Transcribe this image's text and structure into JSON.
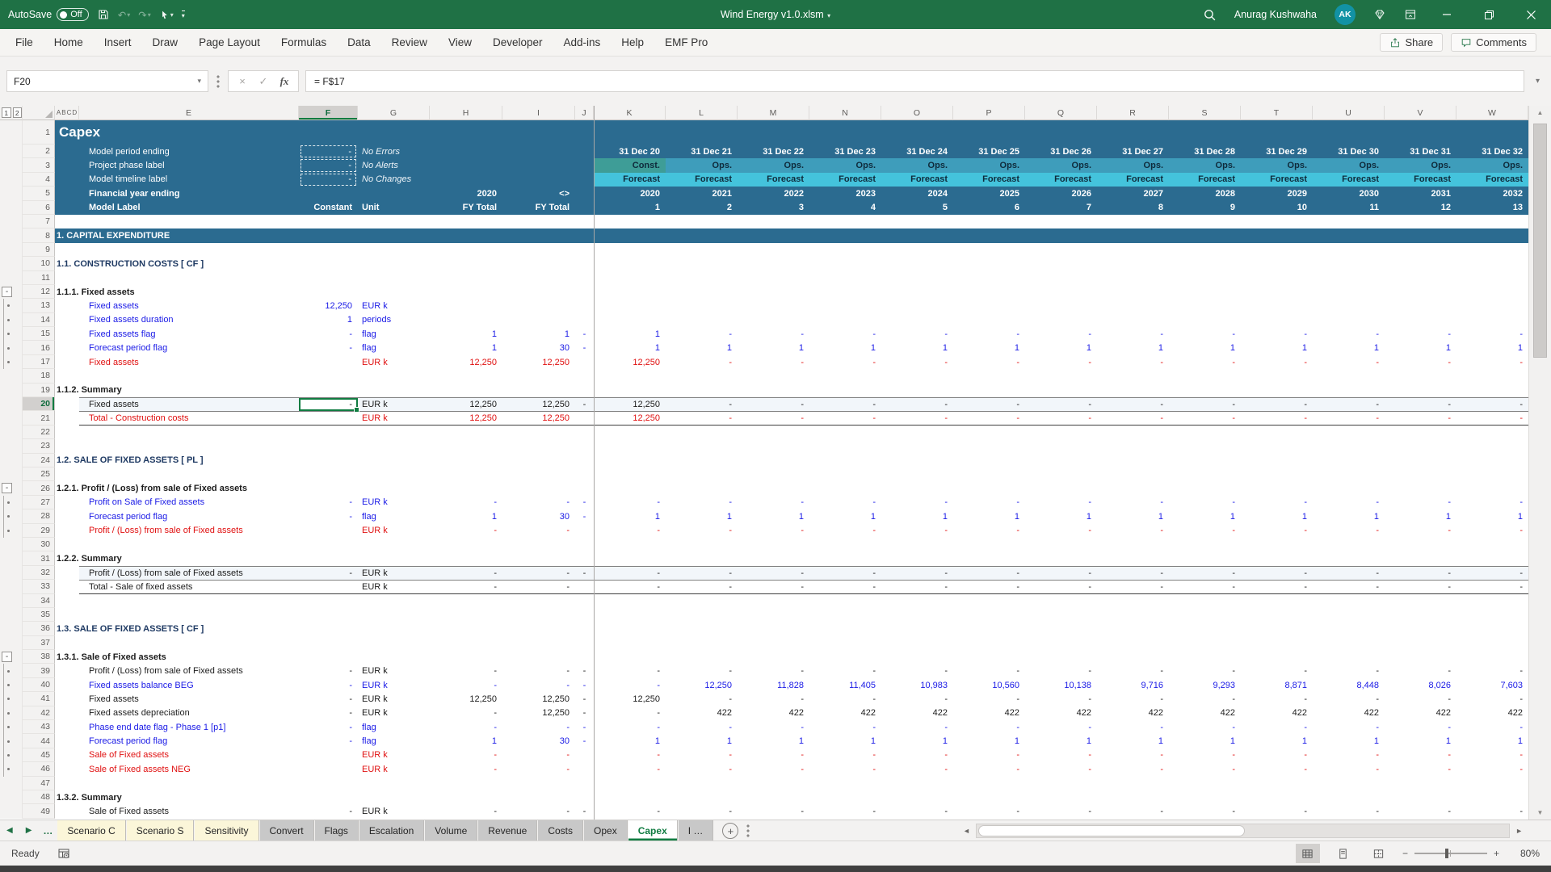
{
  "colors": {
    "titlebar_green": "#1F7145",
    "accent_green": "#107C41",
    "header_blue": "#2B6B90",
    "const_teal": "#3E9D97",
    "ops_teal": "#3E9DBB",
    "forecast_cyan": "#44C3DC",
    "input_blue": "#1A1AE6",
    "result_red": "#E01010",
    "section_navy": "#1F3A63",
    "summary_band": "#F2F6FA",
    "tab_yellow": "#FBF6D9",
    "tab_gray": "#C8C8C8"
  },
  "icons": {
    "dropdown": "▾",
    "undo": "↶",
    "redo": "↷",
    "collapse": "-",
    "formula_cancel": "×",
    "formula_enter": "✓",
    "fx": "fx",
    "expand_formula": "▾",
    "nav_left": "◀",
    "nav_right": "▶",
    "overflow": "…",
    "add_sheet": "+",
    "scroll_up": "▲",
    "scroll_down": "▼",
    "hscroll_left": "◄",
    "hscroll_right": "►",
    "zoom_out": "−",
    "zoom_in": "+"
  },
  "title_bar": {
    "autosave_label": "AutoSave",
    "autosave_state": "Off",
    "document_title": "Wind Energy v1.0.xlsm",
    "user_name": "Anurag Kushwaha",
    "user_initials": "AK"
  },
  "menu_bar": {
    "tabs": [
      "File",
      "Home",
      "Insert",
      "Draw",
      "Page Layout",
      "Formulas",
      "Data",
      "Review",
      "View",
      "Developer",
      "Add-ins",
      "Help",
      "EMF Pro"
    ],
    "share_label": "Share",
    "comments_label": "Comments"
  },
  "formula_bar": {
    "name_box": "F20",
    "formula": "= F$17"
  },
  "grid": {
    "outline_levels": [
      "1",
      "2"
    ],
    "small_columns": [
      "A",
      "B",
      "C",
      "D"
    ],
    "columns": [
      "E",
      "F",
      "G",
      "H",
      "I",
      "J",
      "K",
      "L",
      "M",
      "N",
      "O",
      "P",
      "Q",
      "R",
      "S",
      "T",
      "U",
      "V",
      "W"
    ],
    "selected_column": "F",
    "selected_row": 20,
    "rows": [
      {
        "n": 1,
        "t": "title",
        "e": "Capex"
      },
      {
        "n": 2,
        "t": "hdr",
        "e": "Model period ending",
        "f": "-",
        "fbox": true,
        "g": "No Errors",
        "gitalic": true,
        "k": [
          "31 Dec 20",
          "31 Dec 21",
          "31 Dec 22",
          "31 Dec 23",
          "31 Dec 24",
          "31 Dec 25",
          "31 Dec 26",
          "31 Dec 27",
          "31 Dec 28",
          "31 Dec 29",
          "31 Dec 30",
          "31 Dec 31",
          "31 Dec 32"
        ]
      },
      {
        "n": 3,
        "t": "hdr",
        "e": "Project phase label",
        "f": "-",
        "fbox": true,
        "g": "No Alerts",
        "gitalic": true,
        "kband": "phase",
        "k": [
          "Const.",
          "Ops.",
          "Ops.",
          "Ops.",
          "Ops.",
          "Ops.",
          "Ops.",
          "Ops.",
          "Ops.",
          "Ops.",
          "Ops.",
          "Ops.",
          "Ops."
        ]
      },
      {
        "n": 4,
        "t": "hdr",
        "e": "Model timeline label",
        "f": "-",
        "fbox": true,
        "g": "No Changes",
        "gitalic": true,
        "kband": "forecast",
        "k": [
          "Forecast",
          "Forecast",
          "Forecast",
          "Forecast",
          "Forecast",
          "Forecast",
          "Forecast",
          "Forecast",
          "Forecast",
          "Forecast",
          "Forecast",
          "Forecast",
          "Forecast"
        ]
      },
      {
        "n": 5,
        "t": "hdr",
        "e": "Financial year ending",
        "ebold": true,
        "h": "2020",
        "i": "<>",
        "k": [
          "2020",
          "2021",
          "2022",
          "2023",
          "2024",
          "2025",
          "2026",
          "2027",
          "2028",
          "2029",
          "2030",
          "2031",
          "2032"
        ]
      },
      {
        "n": 6,
        "t": "hdr",
        "e": "Model Label",
        "ebold": true,
        "f": "Constant",
        "g": "Unit",
        "h": "FY Total",
        "i": "FY Total",
        "k": [
          "1",
          "2",
          "3",
          "4",
          "5",
          "6",
          "7",
          "8",
          "9",
          "10",
          "11",
          "12",
          "13"
        ]
      },
      {
        "n": 7,
        "t": "empty"
      },
      {
        "n": 8,
        "t": "band",
        "e": "1. CAPITAL EXPENDITURE"
      },
      {
        "n": 9,
        "t": "empty"
      },
      {
        "n": 10,
        "t": "section",
        "e": "1.1. CONSTRUCTION COSTS [ CF ]"
      },
      {
        "n": 11,
        "t": "empty"
      },
      {
        "n": 12,
        "t": "sub",
        "e": "1.1.1. Fixed assets",
        "ol": "minus"
      },
      {
        "n": 13,
        "t": "data",
        "c": "blue",
        "e": "Fixed assets",
        "f": "12,250",
        "g": "EUR k",
        "ol": "dot"
      },
      {
        "n": 14,
        "t": "data",
        "c": "blue",
        "e": "Fixed assets duration",
        "f": "1",
        "g": "periods",
        "ol": "dot"
      },
      {
        "n": 15,
        "t": "data",
        "c": "blue",
        "e": "Fixed assets flag",
        "f": "-",
        "g": "flag",
        "h": "1",
        "i": "1",
        "j": "-",
        "ol": "dot",
        "k": [
          "1",
          "-",
          "-",
          "-",
          "-",
          "-",
          "-",
          "-",
          "-",
          "-",
          "-",
          "-",
          "-"
        ]
      },
      {
        "n": 16,
        "t": "data",
        "c": "blue",
        "e": "Forecast period flag",
        "f": "-",
        "g": "flag",
        "h": "1",
        "i": "30",
        "j": "-",
        "ol": "dot",
        "k": [
          "1",
          "1",
          "1",
          "1",
          "1",
          "1",
          "1",
          "1",
          "1",
          "1",
          "1",
          "1",
          "1"
        ]
      },
      {
        "n": 17,
        "t": "data",
        "c": "red",
        "e": "Fixed assets",
        "g": "EUR k",
        "h": "12,250",
        "i": "12,250",
        "ol": "dot",
        "k": [
          "12,250",
          "-",
          "-",
          "-",
          "-",
          "-",
          "-",
          "-",
          "-",
          "-",
          "-",
          "-",
          "-"
        ]
      },
      {
        "n": 18,
        "t": "empty"
      },
      {
        "n": 19,
        "t": "sub",
        "e": "1.1.2. Summary"
      },
      {
        "n": 20,
        "t": "data",
        "c": "black",
        "e": "Fixed assets",
        "f": "-",
        "sel": true,
        "g": "EUR k",
        "h": "12,250",
        "i": "12,250",
        "j": "-",
        "bg": true,
        "bt": true,
        "k": [
          "12,250",
          "-",
          "-",
          "-",
          "-",
          "-",
          "-",
          "-",
          "-",
          "-",
          "-",
          "-",
          "-"
        ]
      },
      {
        "n": 21,
        "t": "data",
        "c": "red",
        "e": "Total - Construction costs",
        "g": "EUR k",
        "h": "12,250",
        "i": "12,250",
        "bt": true,
        "bb": true,
        "k": [
          "12,250",
          "-",
          "-",
          "-",
          "-",
          "-",
          "-",
          "-",
          "-",
          "-",
          "-",
          "-",
          "-"
        ]
      },
      {
        "n": 22,
        "t": "empty"
      },
      {
        "n": 23,
        "t": "empty"
      },
      {
        "n": 24,
        "t": "section",
        "e": "1.2. SALE OF FIXED ASSETS [ PL ]"
      },
      {
        "n": 25,
        "t": "empty"
      },
      {
        "n": 26,
        "t": "sub",
        "e": "1.2.1. Profit / (Loss) from sale of Fixed assets",
        "ol": "minus"
      },
      {
        "n": 27,
        "t": "data",
        "c": "blue",
        "e": "Profit on Sale of Fixed assets",
        "f": "-",
        "g": "EUR k",
        "h": "-",
        "i": "-",
        "j": "-",
        "ol": "dot",
        "k": [
          "-",
          "-",
          "-",
          "-",
          "-",
          "-",
          "-",
          "-",
          "-",
          "-",
          "-",
          "-",
          "-"
        ]
      },
      {
        "n": 28,
        "t": "data",
        "c": "blue",
        "e": "Forecast period flag",
        "f": "-",
        "g": "flag",
        "h": "1",
        "i": "30",
        "j": "-",
        "ol": "dot",
        "k": [
          "1",
          "1",
          "1",
          "1",
          "1",
          "1",
          "1",
          "1",
          "1",
          "1",
          "1",
          "1",
          "1"
        ]
      },
      {
        "n": 29,
        "t": "data",
        "c": "red",
        "e": "Profit / (Loss) from sale of Fixed assets",
        "g": "EUR k",
        "h": "-",
        "i": "-",
        "ol": "dot",
        "k": [
          "-",
          "-",
          "-",
          "-",
          "-",
          "-",
          "-",
          "-",
          "-",
          "-",
          "-",
          "-",
          "-"
        ]
      },
      {
        "n": 30,
        "t": "empty"
      },
      {
        "n": 31,
        "t": "sub",
        "e": "1.2.2. Summary"
      },
      {
        "n": 32,
        "t": "data",
        "c": "black",
        "e": "Profit / (Loss) from sale of Fixed assets",
        "f": "-",
        "g": "EUR k",
        "h": "-",
        "i": "-",
        "j": "-",
        "bg": true,
        "bt": true,
        "k": [
          "-",
          "-",
          "-",
          "-",
          "-",
          "-",
          "-",
          "-",
          "-",
          "-",
          "-",
          "-",
          "-"
        ]
      },
      {
        "n": 33,
        "t": "data",
        "c": "black",
        "e": "Total - Sale of fixed assets",
        "g": "EUR k",
        "h": "-",
        "i": "-",
        "bt": true,
        "bb": true,
        "k": [
          "-",
          "-",
          "-",
          "-",
          "-",
          "-",
          "-",
          "-",
          "-",
          "-",
          "-",
          "-",
          "-"
        ]
      },
      {
        "n": 34,
        "t": "empty"
      },
      {
        "n": 35,
        "t": "empty"
      },
      {
        "n": 36,
        "t": "section",
        "e": "1.3. SALE OF FIXED ASSETS [ CF ]"
      },
      {
        "n": 37,
        "t": "empty"
      },
      {
        "n": 38,
        "t": "sub",
        "e": "1.3.1. Sale of Fixed assets",
        "ol": "minus"
      },
      {
        "n": 39,
        "t": "data",
        "c": "black",
        "e": "Profit / (Loss) from sale of Fixed assets",
        "f": "-",
        "g": "EUR k",
        "h": "-",
        "i": "-",
        "j": "-",
        "ol": "dot",
        "k": [
          "-",
          "-",
          "-",
          "-",
          "-",
          "-",
          "-",
          "-",
          "-",
          "-",
          "-",
          "-",
          "-"
        ]
      },
      {
        "n": 40,
        "t": "data",
        "c": "blue",
        "e": "Fixed assets balance BEG",
        "f": "-",
        "g": "EUR k",
        "h": "-",
        "i": "-",
        "j": "-",
        "ol": "dot",
        "k": [
          "-",
          "12,250",
          "11,828",
          "11,405",
          "10,983",
          "10,560",
          "10,138",
          "9,716",
          "9,293",
          "8,871",
          "8,448",
          "8,026",
          "7,603"
        ]
      },
      {
        "n": 41,
        "t": "data",
        "c": "black",
        "e": "Fixed assets",
        "f": "-",
        "g": "EUR k",
        "h": "12,250",
        "i": "12,250",
        "j": "-",
        "ol": "dot",
        "k": [
          "12,250",
          "-",
          "-",
          "-",
          "-",
          "-",
          "-",
          "-",
          "-",
          "-",
          "-",
          "-",
          "-"
        ]
      },
      {
        "n": 42,
        "t": "data",
        "c": "black",
        "e": "Fixed assets depreciation",
        "f": "-",
        "g": "EUR k",
        "h": "-",
        "i": "12,250",
        "j": "-",
        "ol": "dot",
        "k": [
          "-",
          "422",
          "422",
          "422",
          "422",
          "422",
          "422",
          "422",
          "422",
          "422",
          "422",
          "422",
          "422"
        ]
      },
      {
        "n": 43,
        "t": "data",
        "c": "blue",
        "e": "Phase end date flag - Phase 1 [p1]",
        "f": "-",
        "g": "flag",
        "h": "-",
        "i": "-",
        "j": "-",
        "ol": "dot",
        "k": [
          "-",
          "-",
          "-",
          "-",
          "-",
          "-",
          "-",
          "-",
          "-",
          "-",
          "-",
          "-",
          "-"
        ]
      },
      {
        "n": 44,
        "t": "data",
        "c": "blue",
        "e": "Forecast period flag",
        "f": "-",
        "g": "flag",
        "h": "1",
        "i": "30",
        "j": "-",
        "ol": "dot",
        "k": [
          "1",
          "1",
          "1",
          "1",
          "1",
          "1",
          "1",
          "1",
          "1",
          "1",
          "1",
          "1",
          "1"
        ]
      },
      {
        "n": 45,
        "t": "data",
        "c": "red",
        "e": "Sale of Fixed assets",
        "g": "EUR k",
        "h": "-",
        "i": "-",
        "ol": "dot",
        "k": [
          "-",
          "-",
          "-",
          "-",
          "-",
          "-",
          "-",
          "-",
          "-",
          "-",
          "-",
          "-",
          "-"
        ]
      },
      {
        "n": 46,
        "t": "data",
        "c": "red",
        "e": "Sale of Fixed assets NEG",
        "g": "EUR k",
        "h": "-",
        "i": "-",
        "ol": "dot",
        "k": [
          "-",
          "-",
          "-",
          "-",
          "-",
          "-",
          "-",
          "-",
          "-",
          "-",
          "-",
          "-",
          "-"
        ]
      },
      {
        "n": 47,
        "t": "empty"
      },
      {
        "n": 48,
        "t": "sub",
        "e": "1.3.2. Summary"
      },
      {
        "n": 49,
        "t": "data",
        "c": "black",
        "e": "Sale of Fixed assets",
        "f": "-",
        "g": "EUR k",
        "h": "-",
        "i": "-",
        "j": "-",
        "k": [
          "-",
          "-",
          "-",
          "-",
          "-",
          "-",
          "-",
          "-",
          "-",
          "-",
          "-",
          "-",
          "-"
        ]
      }
    ]
  },
  "sheet_bar": {
    "tabs": [
      {
        "label": "Scenario C",
        "style": "yellow"
      },
      {
        "label": "Scenario S",
        "style": "yellow"
      },
      {
        "label": "Sensitivity",
        "style": "yellow"
      },
      {
        "label": "Convert",
        "style": "gray"
      },
      {
        "label": "Flags",
        "style": "gray"
      },
      {
        "label": "Escalation",
        "style": "gray"
      },
      {
        "label": "Volume",
        "style": "gray"
      },
      {
        "label": "Revenue",
        "style": "gray"
      },
      {
        "label": "Costs",
        "style": "gray"
      },
      {
        "label": "Opex",
        "style": "gray"
      },
      {
        "label": "Capex",
        "style": "active"
      },
      {
        "label": "I …",
        "style": "gray"
      }
    ]
  },
  "status_bar": {
    "mode": "Ready",
    "zoom_level": "80%"
  }
}
